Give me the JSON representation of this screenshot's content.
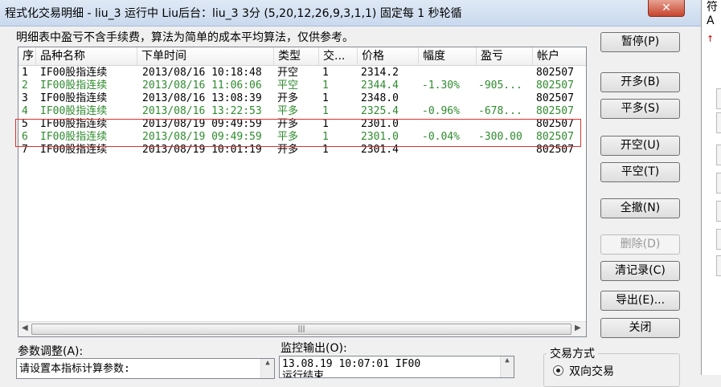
{
  "window": {
    "title": "程式化交易明细 - liu_3 运行中  Liu后台：liu_3 3分 (5,20,12,26,9,3,1,1) 固定每 1 秒轮循",
    "close_glyph": "✕"
  },
  "info_text": "明细表中盈亏不含手续费，算法为简单的成本平均算法，仅供参考。",
  "table": {
    "columns": [
      "序",
      "品种名称",
      "下单时间",
      "类型",
      "交...",
      "价格",
      "幅度",
      "盈亏",
      "帐户"
    ],
    "rows": [
      {
        "seq": "1",
        "name": "IF00股指连续",
        "time": "2013/08/16 10:18:48",
        "type": "开空",
        "qty": "1",
        "price": "2314.2",
        "range": "",
        "pnl": "",
        "account": "802507",
        "color": "#000000"
      },
      {
        "seq": "2",
        "name": "IF00股指连续",
        "time": "2013/08/16 11:06:06",
        "type": "平空",
        "qty": "1",
        "price": "2344.4",
        "range": "-1.30%",
        "pnl": "-905...",
        "account": "802507",
        "color": "#2e8b2e"
      },
      {
        "seq": "3",
        "name": "IF00股指连续",
        "time": "2013/08/16 13:08:39",
        "type": "开多",
        "qty": "1",
        "price": "2348.0",
        "range": "",
        "pnl": "",
        "account": "802507",
        "color": "#000000"
      },
      {
        "seq": "4",
        "name": "IF00股指连续",
        "time": "2013/08/16 13:22:53",
        "type": "平多",
        "qty": "1",
        "price": "2325.4",
        "range": "-0.96%",
        "pnl": "-678...",
        "account": "802507",
        "color": "#2e8b2e"
      },
      {
        "seq": "5",
        "name": "IF00股指连续",
        "time": "2013/08/19 09:49:59",
        "type": "开多",
        "qty": "1",
        "price": "2301.0",
        "range": "",
        "pnl": "",
        "account": "802507",
        "color": "#000000"
      },
      {
        "seq": "6",
        "name": "IF00股指连续",
        "time": "2013/08/19 09:49:59",
        "type": "平多",
        "qty": "1",
        "price": "2301.0",
        "range": "-0.04%",
        "pnl": "-300.00",
        "account": "802507",
        "color": "#2e8b2e"
      },
      {
        "seq": "7",
        "name": "IF00股指连续",
        "time": "2013/08/19 10:01:19",
        "type": "开多",
        "qty": "1",
        "price": "2301.4",
        "range": "",
        "pnl": "",
        "account": "802507",
        "color": "#000000"
      }
    ]
  },
  "buttons": {
    "pause": "暂停(P)",
    "open_long": "开多(B)",
    "close_long": "平多(S)",
    "open_short": "开空(U)",
    "close_short": "平空(T)",
    "cancel_all": "全撤(N)",
    "delete": "删除(D)",
    "clear_log": "清记录(C)",
    "export": "导出(E)...",
    "close": "关闭"
  },
  "params": {
    "label": "参数调整(A):",
    "text": "请设置本指标计算参数:"
  },
  "monitor": {
    "label": "监控输出(O):",
    "line1": "13.08.19 10:07:01 IF00",
    "line2": "运行结束"
  },
  "trade_mode": {
    "label": "交易方式",
    "option": "双向交易"
  },
  "right_strip": {
    "text1": "符",
    "text2": "A",
    "arrow": "↑"
  },
  "colors": {
    "loss_row": "#2e8b2e",
    "highlight_border": "#d9322f"
  }
}
